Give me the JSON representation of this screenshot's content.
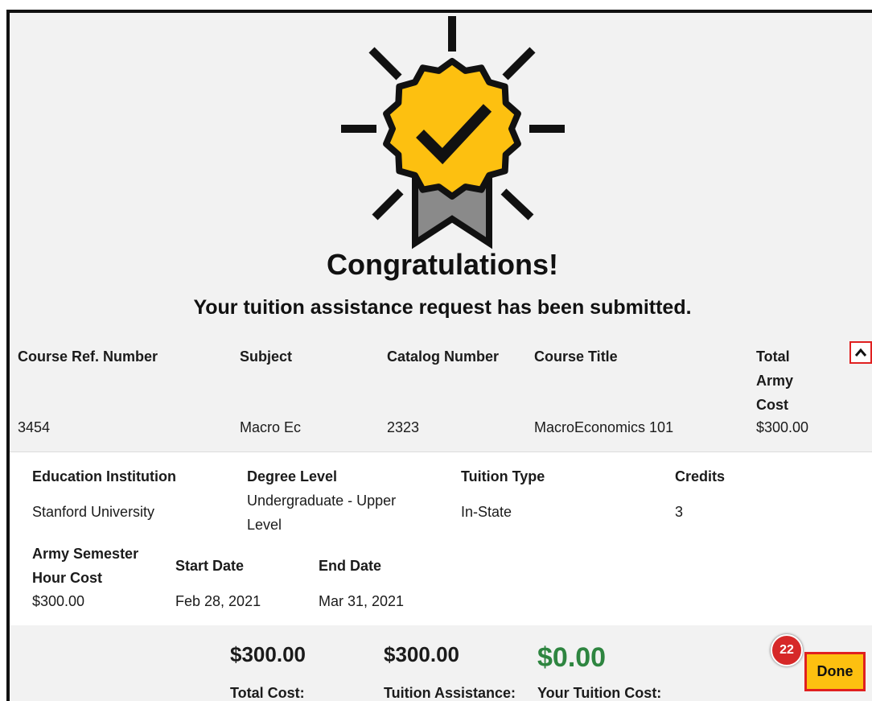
{
  "heading": {
    "title": "Congratulations!",
    "subtitle": "Your tuition assistance request has been submitted."
  },
  "course_table": {
    "headers": [
      "Course Ref. Number",
      "Subject",
      "Catalog Number",
      "Course Title",
      "Total",
      "Army",
      "Cost"
    ],
    "row": [
      "3454",
      "Macro Ec",
      "2323",
      "MacroEconomics 101",
      "$300.00"
    ]
  },
  "details": {
    "education_institution": {
      "label": "Education Institution",
      "value": "Stanford University"
    },
    "degree_level": {
      "label": "Degree Level",
      "value_line1": "Undergraduate - Upper",
      "value_line2": "Level"
    },
    "tuition_type": {
      "label": "Tuition Type",
      "value": "In-State"
    },
    "credits": {
      "label": "Credits",
      "value": "3"
    },
    "army_semester_hour_cost": {
      "label_line1": "Army Semester",
      "label_line2": "Hour Cost",
      "value": "$300.00"
    },
    "start_date": {
      "label": "Start Date",
      "value": "Feb 28, 2021"
    },
    "end_date": {
      "label": "End Date",
      "value": "Mar 31, 2021"
    }
  },
  "summary": {
    "total_cost": {
      "amount": "$300.00",
      "label": "Total Cost:"
    },
    "tuition_assistance": {
      "amount": "$300.00",
      "label": "Tuition Assistance:"
    },
    "your_tuition_cost": {
      "amount": "$0.00",
      "label": "Your Tuition Cost:"
    }
  },
  "actions": {
    "done_label": "Done",
    "step_number": "22"
  },
  "colors": {
    "badge_gold": "#fdc010",
    "ribbon_gray": "#8a8a8a",
    "accent_red": "#e02020",
    "success_green": "#2e8540"
  },
  "icons": {
    "badge": "award-badge-check-icon",
    "collapse": "chevron-up-icon"
  }
}
